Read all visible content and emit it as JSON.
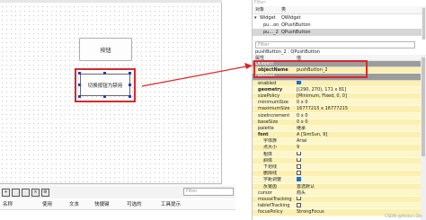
{
  "canvas": {
    "button1_label": "按钮",
    "button2_label": "切换按钮为禁用"
  },
  "colors": {
    "accent_red": "#d8282c",
    "handle_blue": "#1a3dd8",
    "cat_gray": "#9c9c9c",
    "row_yellow": "#fdf6c8"
  },
  "bottom": {
    "toolbar_icons": [
      "icon-new",
      "icon-copy",
      "icon-paste",
      "icon-delete",
      "icon-settings"
    ],
    "filter_placeholder": "Filter",
    "columns": [
      "名称",
      "使用",
      "文本",
      "快捷键",
      "可选的",
      "工具提示"
    ]
  },
  "inspector": {
    "filter_placeholder": "Filter",
    "col_object": "对象",
    "col_class": "类",
    "rows": [
      {
        "object": "Widget",
        "class": "QWidget",
        "expander": "▾"
      },
      {
        "object": "pu...on",
        "class": "QPushButton",
        "expander": ""
      },
      {
        "object": "pu..._2",
        "class": "QPushButton",
        "expander": ""
      }
    ]
  },
  "property": {
    "filter_placeholder": "Filter",
    "title": "pushButton_2 : QPushButton",
    "col_prop": "属性",
    "col_value": "值",
    "rows": [
      {
        "name": "QObject",
        "value": "",
        "type": "cat"
      },
      {
        "name": "objectName",
        "value": "pushButton_2",
        "type": "bold"
      },
      {
        "name": "QWidget",
        "value": "",
        "type": "cat"
      },
      {
        "name": "enabled",
        "value": "",
        "type": "check"
      },
      {
        "name": "geometry",
        "value": "[(290, 270), 171 x 81]",
        "type": "bold"
      },
      {
        "name": "sizePolicy",
        "value": "[Minimum, Fixed, 0, 0]",
        "type": "plain"
      },
      {
        "name": "minimumSize",
        "value": "0 x 0",
        "type": "plain"
      },
      {
        "name": "maximumSize",
        "value": "16777215 x 16777215",
        "type": "plain"
      },
      {
        "name": "sizeIncrement",
        "value": "0 x 0",
        "type": "plain"
      },
      {
        "name": "baseSize",
        "value": "0 x 0",
        "type": "plain"
      },
      {
        "name": "palette",
        "value": "继承",
        "type": "plain"
      },
      {
        "name": "font",
        "value": "A [SimSun, 9]",
        "type": "bold"
      },
      {
        "name": "字体族",
        "value": "Arial",
        "type": "sub"
      },
      {
        "name": "点大小",
        "value": "9",
        "type": "sub"
      },
      {
        "name": "粗体",
        "value": "",
        "type": "subcheck"
      },
      {
        "name": "斜体",
        "value": "",
        "type": "subcheck"
      },
      {
        "name": "下划线",
        "value": "",
        "type": "subcheck"
      },
      {
        "name": "删除线",
        "value": "",
        "type": "subcheck"
      },
      {
        "name": "字距调整",
        "value": "",
        "type": "subcheckon"
      },
      {
        "name": "反锯齿",
        "value": "首选默认",
        "type": "sub"
      },
      {
        "name": "cursor",
        "value": "箭头",
        "type": "plain"
      },
      {
        "name": "mouseTracking",
        "value": "",
        "type": "check0"
      },
      {
        "name": "tabletTracking",
        "value": "",
        "type": "check0"
      },
      {
        "name": "focusPolicy",
        "value": "StrongFocus",
        "type": "plain"
      }
    ]
  },
  "watermark": "CSDN @Alston.Qin"
}
